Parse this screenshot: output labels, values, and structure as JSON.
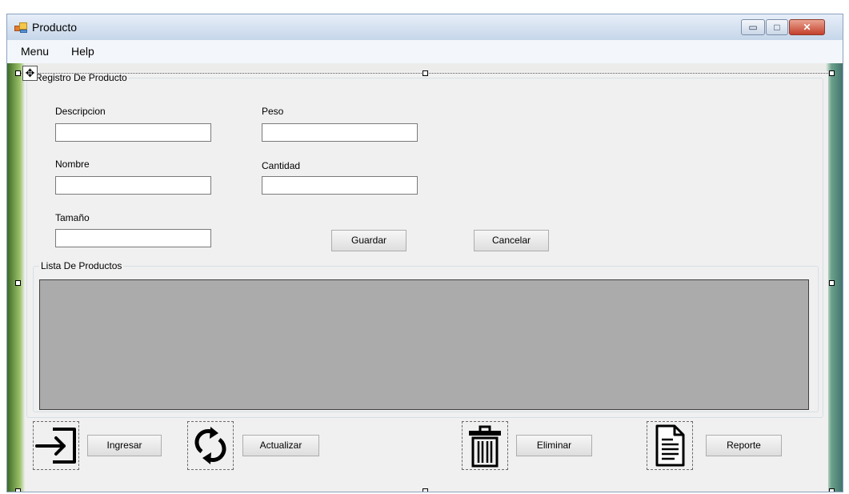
{
  "window": {
    "title": "Producto",
    "icons": {
      "app": "form-app-icon",
      "minimize": "minimize-icon",
      "maximize": "maximize-icon",
      "close": "close-icon"
    },
    "controls": {
      "minimize": "▭",
      "maximize": "□",
      "close": "✕"
    }
  },
  "menu": {
    "items": [
      "Menu",
      "Help"
    ]
  },
  "registro": {
    "title": "Registro De Producto",
    "fields": {
      "descripcion": {
        "label": "Descripcion",
        "value": ""
      },
      "nombre": {
        "label": "Nombre",
        "value": ""
      },
      "tamano": {
        "label": "Tamaño",
        "value": ""
      },
      "peso": {
        "label": "Peso",
        "value": ""
      },
      "cantidad": {
        "label": "Cantidad",
        "value": ""
      }
    },
    "buttons": {
      "guardar": "Guardar",
      "cancelar": "Cancelar"
    }
  },
  "lista": {
    "title": "Lista De Productos"
  },
  "actions": [
    {
      "icon": "sign-in-icon",
      "label": "Ingresar"
    },
    {
      "icon": "refresh-icon",
      "label": "Actualizar"
    },
    {
      "icon": "trash-icon",
      "label": "Eliminar"
    },
    {
      "icon": "document-icon",
      "label": "Reporte"
    }
  ],
  "designer": {
    "move_icon": "move-icon",
    "move_glyph": "✥"
  },
  "colors": {
    "titlebar": "#c6d6ea",
    "form_bg": "#f0f0f0",
    "grid_bg": "#ababab",
    "close_button": "#c4402c"
  }
}
